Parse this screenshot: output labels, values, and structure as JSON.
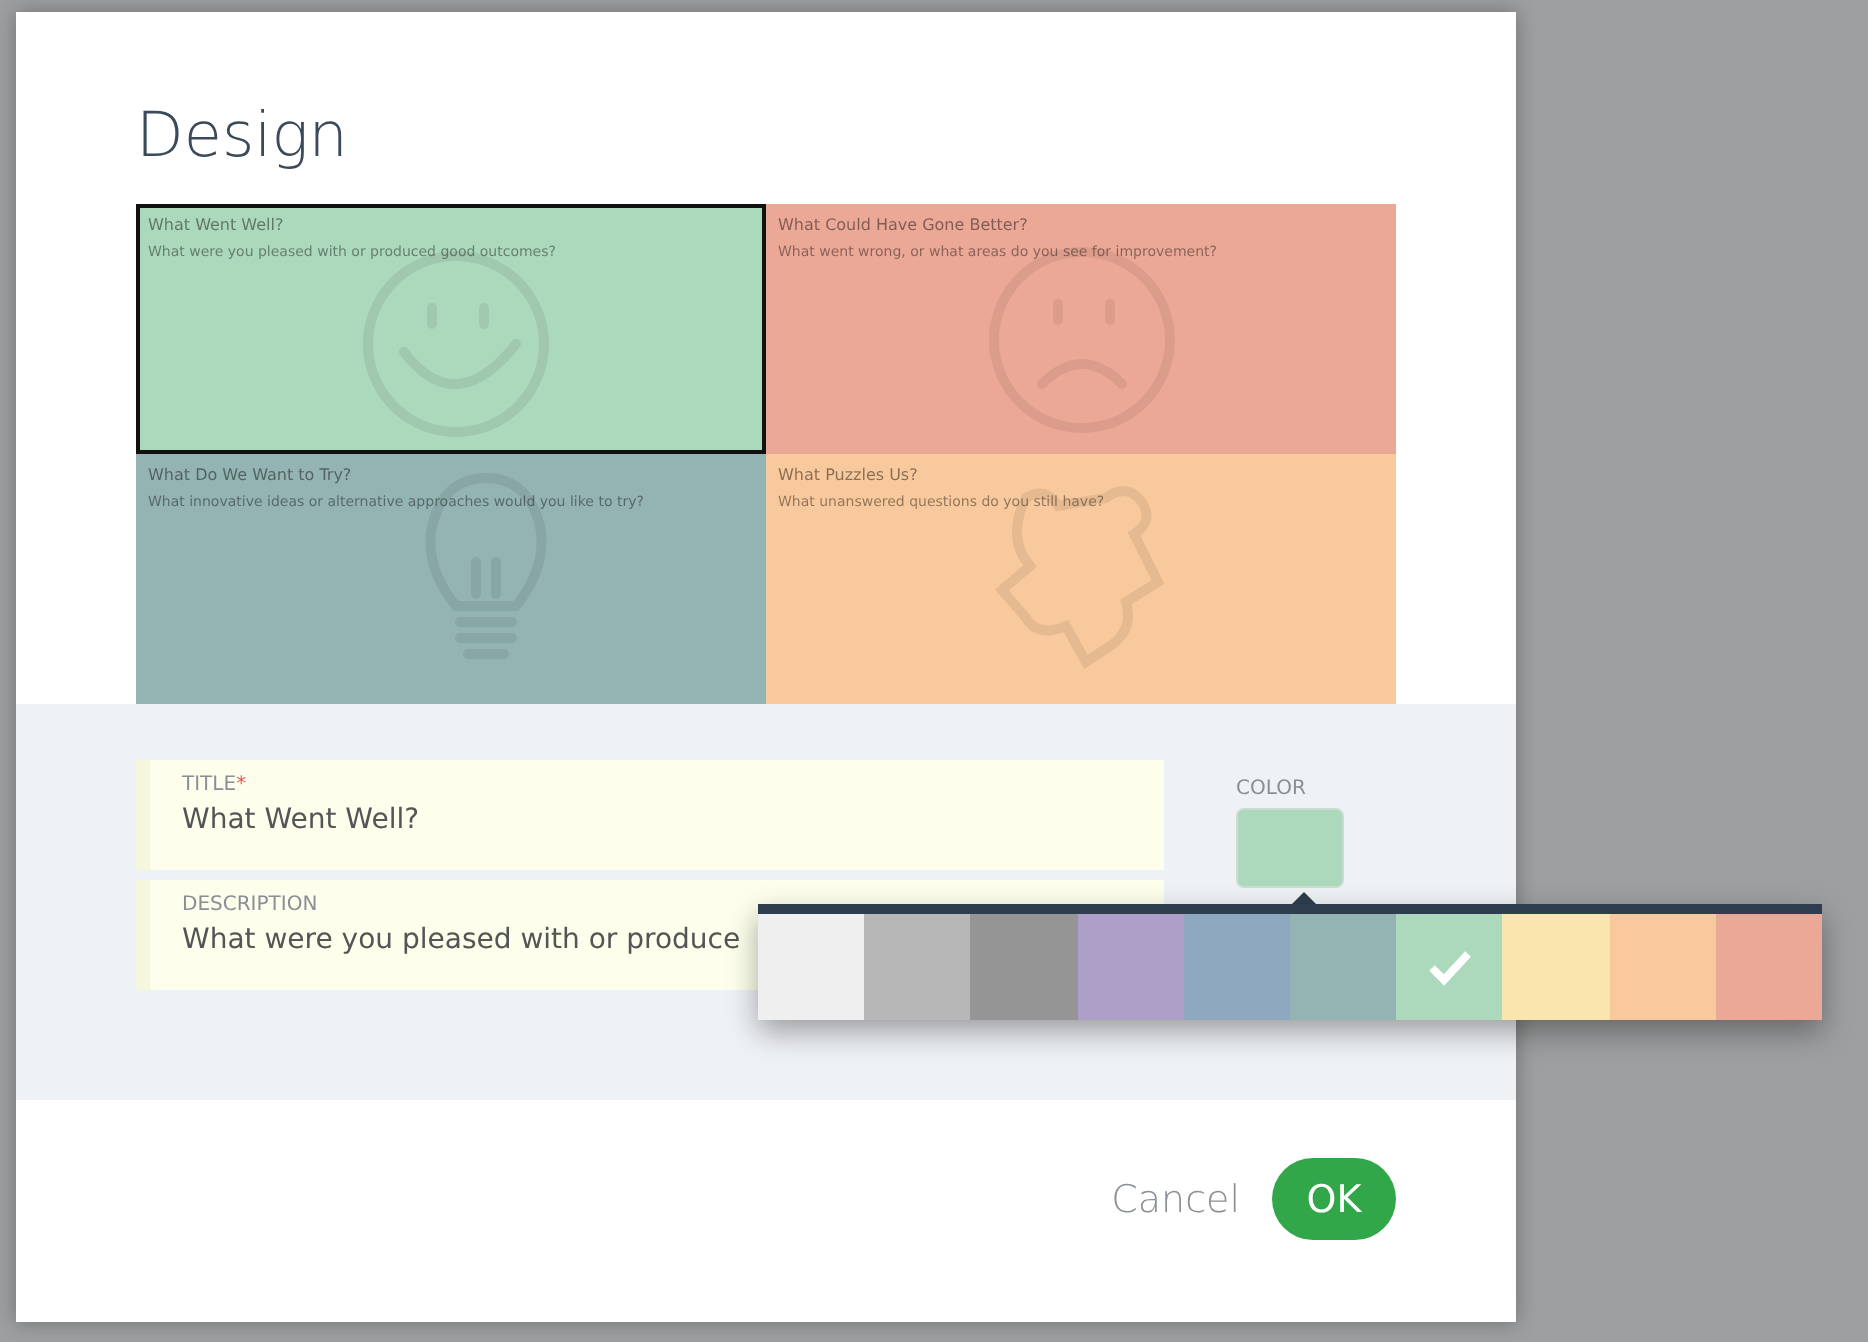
{
  "dialog": {
    "title": "Design"
  },
  "cells": [
    {
      "kind": "smile",
      "title": "What Went Well?",
      "description": "What were you pleased with or produced good outcomes?",
      "color": "#acd8bc",
      "selected": true
    },
    {
      "kind": "frown",
      "title": "What Could Have Gone Better?",
      "description": "What went wrong, or what areas do you see for improvement?",
      "color": "#eca896",
      "selected": false
    },
    {
      "kind": "bulb",
      "title": "What Do We Want to Try?",
      "description": "What innovative ideas or alternative approaches would you like to try?",
      "color": "#94b3b3",
      "selected": false
    },
    {
      "kind": "puzzle",
      "title": "What Puzzles Us?",
      "description": "What unanswered questions do you still have?",
      "color": "#f8c99c",
      "selected": false
    }
  ],
  "form": {
    "title_label": "TITLE",
    "required_mark": "*",
    "title_value": "What Went Well?",
    "description_label": "DESCRIPTION",
    "description_value": "What were you pleased with or produce",
    "color_label": "COLOR"
  },
  "palette": [
    {
      "color": "#efefef",
      "selected": false
    },
    {
      "color": "#b7b7b7",
      "selected": false
    },
    {
      "color": "#959595",
      "selected": false
    },
    {
      "color": "#ae9fc8",
      "selected": false
    },
    {
      "color": "#8ea8c0",
      "selected": false
    },
    {
      "color": "#94b3b3",
      "selected": false
    },
    {
      "color": "#acd8bc",
      "selected": true
    },
    {
      "color": "#fbe5ae",
      "selected": false
    },
    {
      "color": "#f8c99c",
      "selected": false
    },
    {
      "color": "#eca896",
      "selected": false
    }
  ],
  "buttons": {
    "cancel": "Cancel",
    "ok": "OK"
  }
}
